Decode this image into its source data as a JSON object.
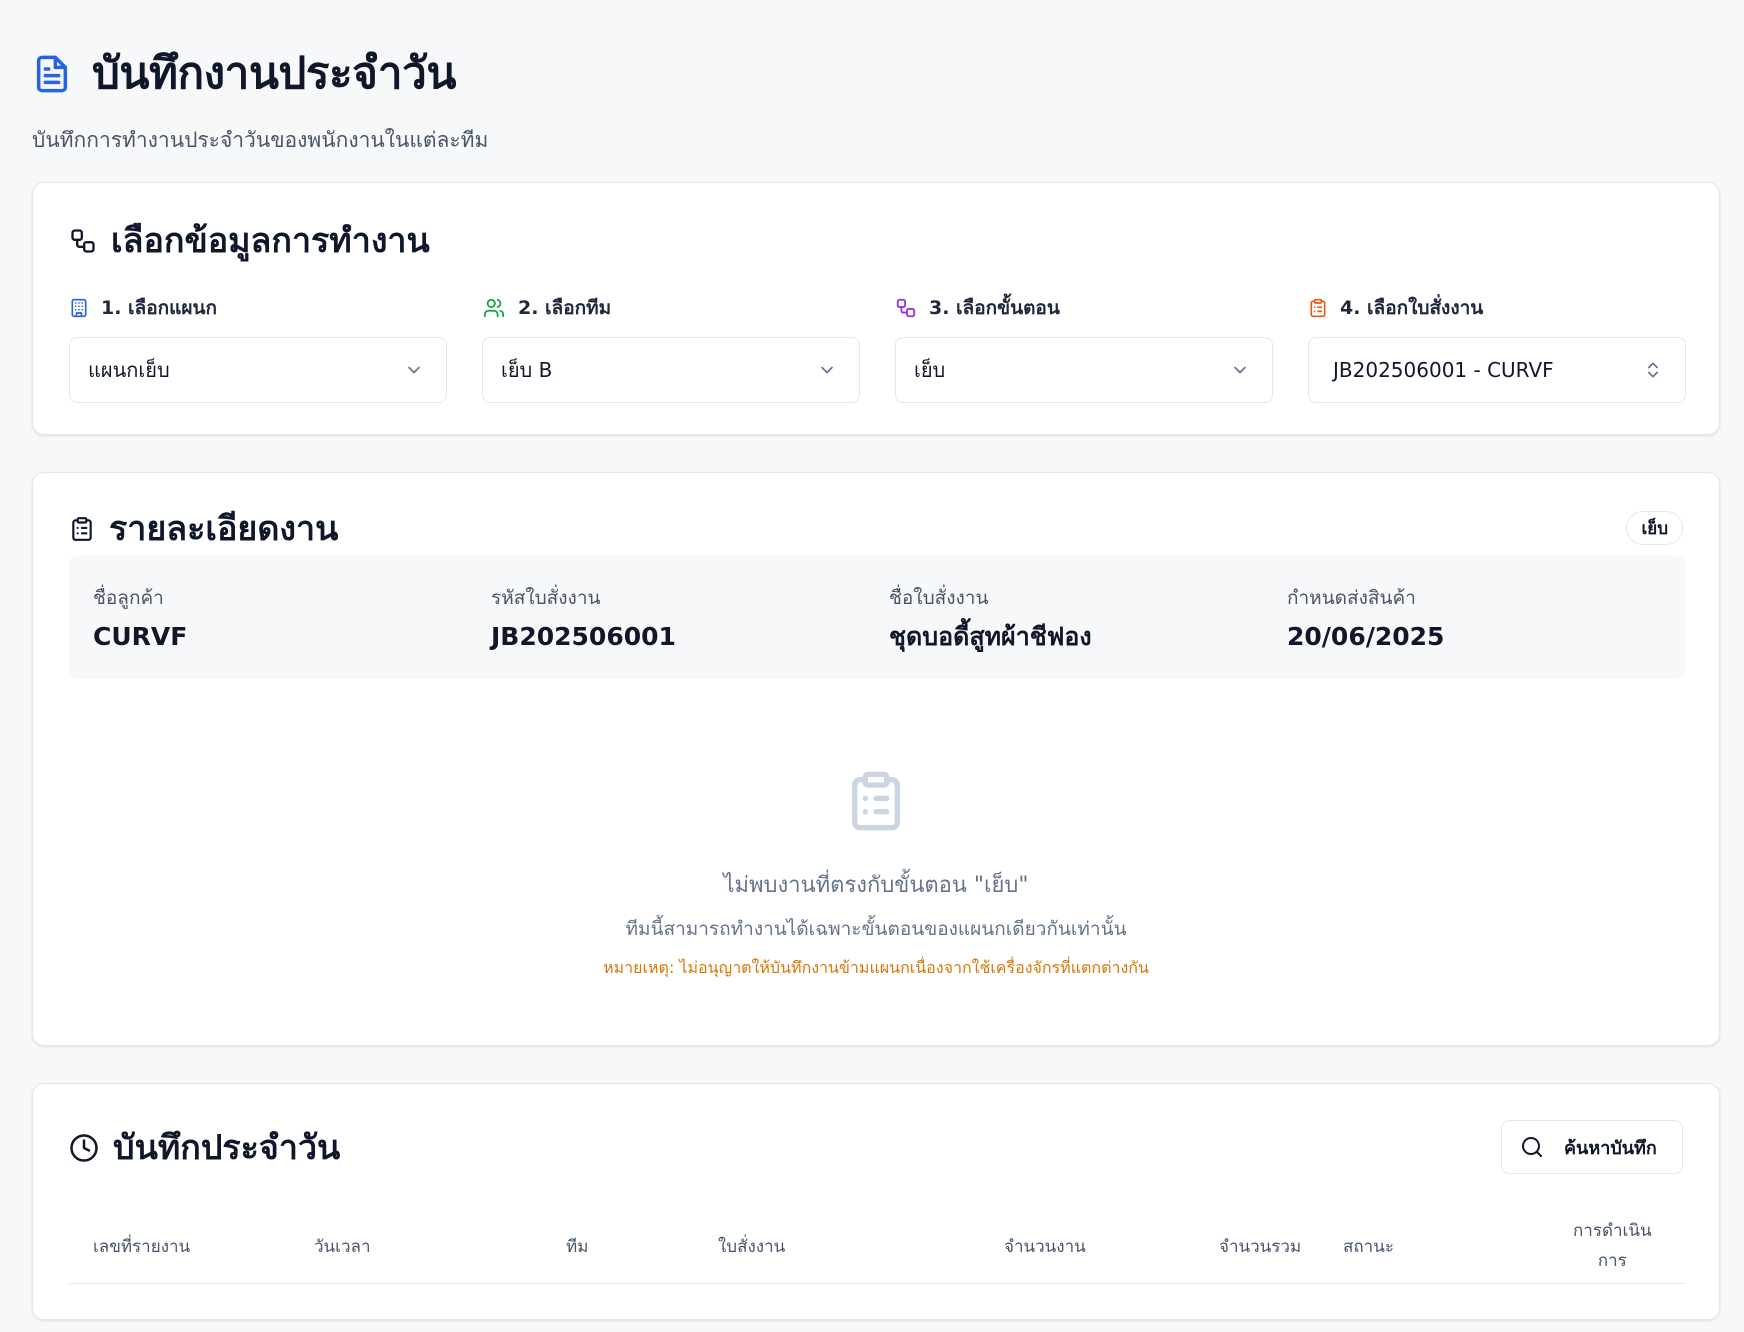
{
  "page": {
    "title": "บันทึกงานประจำวัน",
    "subtitle": "บันทึกการทำงานประจำวันของพนักงานในแต่ละทีม"
  },
  "selection": {
    "title": "เลือกข้อมูลการทำงาน",
    "selectors": [
      {
        "label": "1. เลือกแผนก",
        "value": "แผนกเย็บ",
        "icon": "building-icon",
        "icon_color": "#2563eb"
      },
      {
        "label": "2. เลือกทีม",
        "value": "เย็บ B",
        "icon": "users-icon",
        "icon_color": "#16a34a"
      },
      {
        "label": "3. เลือกขั้นตอน",
        "value": "เย็บ",
        "icon": "workflow-icon",
        "icon_color": "#9333ea"
      },
      {
        "label": "4. เลือกใบสั่งงาน",
        "value": "JB202506001 - CURVF",
        "icon": "clipboard-list-icon",
        "icon_color": "#ea580c"
      }
    ]
  },
  "details": {
    "title": "รายละเอียดงาน",
    "step_badge": "เย็บ",
    "fields": [
      {
        "label": "ชื่อลูกค้า",
        "value": "CURVF"
      },
      {
        "label": "รหัสใบสั่งงาน",
        "value": "JB202506001"
      },
      {
        "label": "ชื่อใบสั่งงาน",
        "value": "ชุดบอดี้สูทผ้าชีฟอง"
      },
      {
        "label": "กำหนดส่งสินค้า",
        "value": "20/06/2025"
      }
    ],
    "empty": {
      "title": "ไม่พบงานที่ตรงกับขั้นตอน \"เย็บ\"",
      "subtitle": "ทีมนี้สามารถทำงานได้เฉพาะขั้นตอนของแผนกเดียวกันเท่านั้น",
      "note": "หมายเหตุ: ไม่อนุญาตให้บันทึกงานข้ามแผนกเนื่องจากใช้เครื่องจักรที่แตกต่างกัน",
      "note_color": "#d97706"
    }
  },
  "logs": {
    "title": "บันทึกประจำวัน",
    "search_label": "ค้นหาบันทึก",
    "columns": [
      "เลขที่รายงาน",
      "วันเวลา",
      "ทีม",
      "ใบสั่งงาน",
      "จำนวนงาน",
      "จำนวนรวม",
      "สถานะ"
    ],
    "actions_header": [
      "การดำเนิน",
      "การ"
    ]
  },
  "colors": {
    "accent": "#2563eb",
    "background": "#f7f8fa",
    "card": "#ffffff",
    "border": "#e5e7eb"
  }
}
